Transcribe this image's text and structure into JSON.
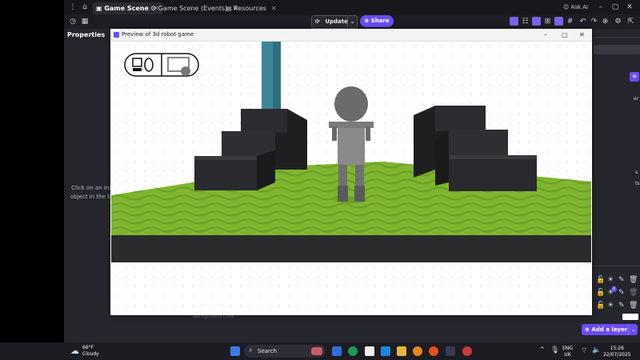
{
  "app": {
    "tabs": [
      {
        "label": "Game Scene",
        "active": true
      },
      {
        "label": "Game Scene (Events)",
        "active": false
      },
      {
        "label": "Resources",
        "active": false
      }
    ],
    "ask_ai": "Ask AI",
    "update_label": "Update",
    "share_label": "Share",
    "add_layer_label": "Add a layer",
    "status_text": "Background color"
  },
  "properties": {
    "title": "Properties",
    "hint_line1": "Click on an insta",
    "hint_line2": "object in the list t"
  },
  "right_panel": {
    "fragments": [
      "er",
      "s",
      "ts"
    ],
    "badge_count": "2"
  },
  "preview": {
    "title": "Preview of 3d robot game"
  },
  "colors": {
    "accent": "#6b4cf6",
    "grass": "#7fb52f",
    "block": "#2b2b2f",
    "pillar": "#3b8797",
    "robot": "#8a8a8a"
  },
  "taskbar": {
    "weather_temp": "66°F",
    "weather_desc": "Cloudy",
    "search_label": "Search",
    "lang_line1": "ENG",
    "lang_line2": "UK",
    "time": "15:26",
    "date": "22/07/2025"
  }
}
